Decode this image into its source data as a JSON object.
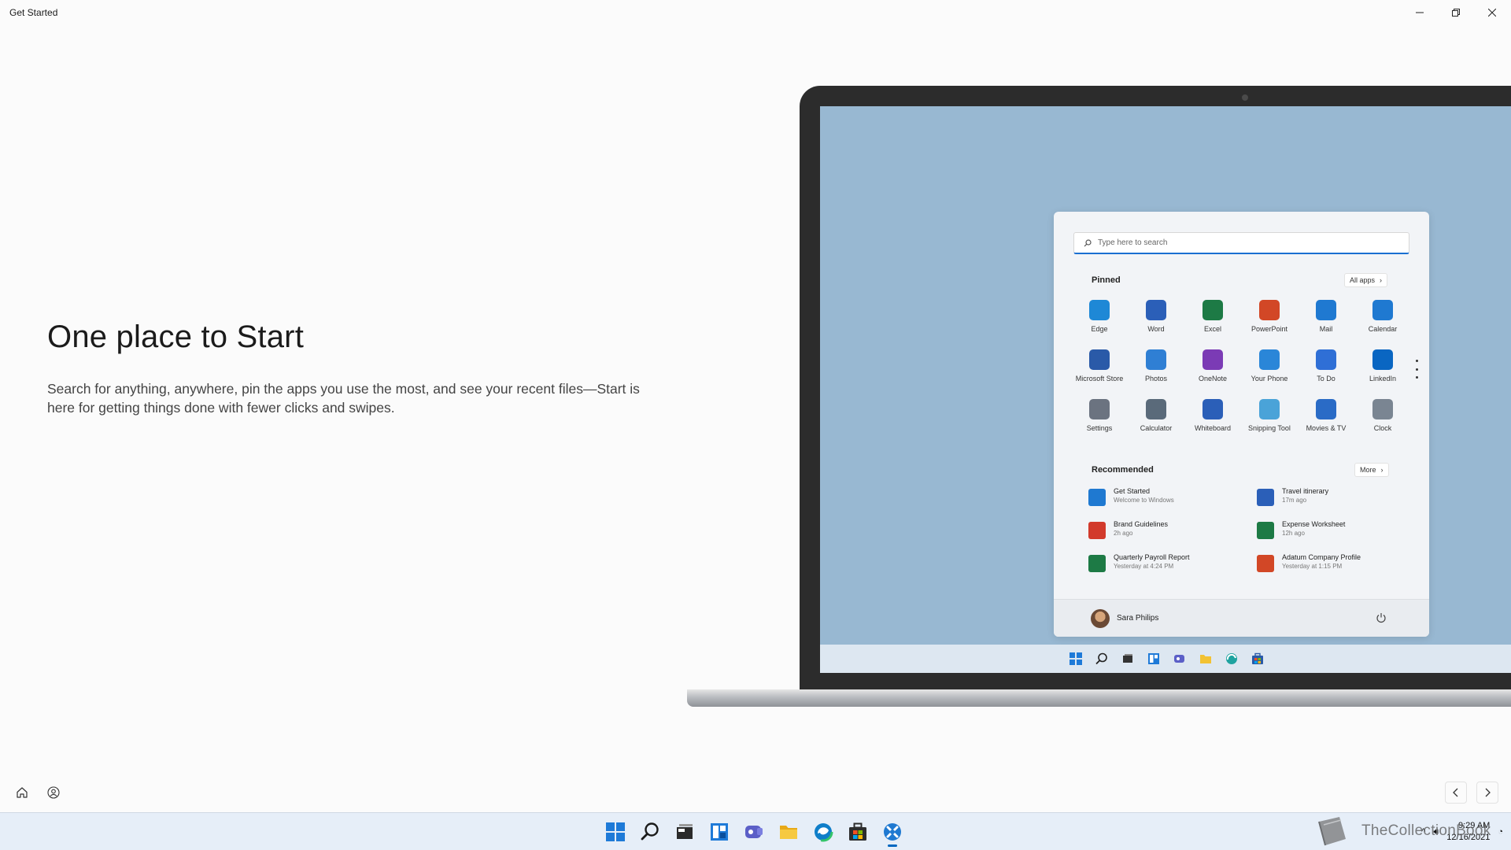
{
  "window": {
    "title": "Get Started"
  },
  "hero": {
    "headline": "One place to Start",
    "description": "Search for anything, anywhere, pin the apps you use the most, and see your recent files—Start is here for getting things done with fewer clicks and swipes."
  },
  "start_menu": {
    "search_placeholder": "Type here to search",
    "pinned_title": "Pinned",
    "all_apps_label": "All apps",
    "pinned_apps": [
      {
        "label": "Edge",
        "icon": "edge-icon",
        "color": "#1e88d6"
      },
      {
        "label": "Word",
        "icon": "word-icon",
        "color": "#2b5fb8"
      },
      {
        "label": "Excel",
        "icon": "excel-icon",
        "color": "#1d7a45"
      },
      {
        "label": "PowerPoint",
        "icon": "powerpoint-icon",
        "color": "#d24726"
      },
      {
        "label": "Mail",
        "icon": "mail-icon",
        "color": "#1f79d1"
      },
      {
        "label": "Calendar",
        "icon": "calendar-icon",
        "color": "#1f79d1"
      },
      {
        "label": "Microsoft Store",
        "icon": "store-icon",
        "color": "#2a5aa8"
      },
      {
        "label": "Photos",
        "icon": "photos-icon",
        "color": "#2f7fd4"
      },
      {
        "label": "OneNote",
        "icon": "onenote-icon",
        "color": "#7b3bb5"
      },
      {
        "label": "Your Phone",
        "icon": "phone-icon",
        "color": "#2a86d8"
      },
      {
        "label": "To Do",
        "icon": "todo-icon",
        "color": "#2f6fd6"
      },
      {
        "label": "LinkedIn",
        "icon": "linkedin-icon",
        "color": "#0a66c2"
      },
      {
        "label": "Settings",
        "icon": "settings-icon",
        "color": "#6b7380"
      },
      {
        "label": "Calculator",
        "icon": "calculator-icon",
        "color": "#5a6a7a"
      },
      {
        "label": "Whiteboard",
        "icon": "whiteboard-icon",
        "color": "#2b5fb8"
      },
      {
        "label": "Snipping Tool",
        "icon": "snipping-icon",
        "color": "#4aa3d8"
      },
      {
        "label": "Movies & TV",
        "icon": "movies-icon",
        "color": "#2a6bc6"
      },
      {
        "label": "Clock",
        "icon": "clock-icon",
        "color": "#7a8592"
      }
    ],
    "recommended_title": "Recommended",
    "more_label": "More",
    "recommended": [
      {
        "name": "Get Started",
        "sub": "Welcome to Windows",
        "icon": "get-started-icon",
        "color": "#1f79d1"
      },
      {
        "name": "Travel itinerary",
        "sub": "17m ago",
        "icon": "word-doc-icon",
        "color": "#2b5fb8"
      },
      {
        "name": "Brand Guidelines",
        "sub": "2h ago",
        "icon": "pdf-icon",
        "color": "#d23a2c"
      },
      {
        "name": "Expense Worksheet",
        "sub": "12h ago",
        "icon": "excel-doc-icon",
        "color": "#1d7a45"
      },
      {
        "name": "Quarterly Payroll Report",
        "sub": "Yesterday at 4:24 PM",
        "icon": "excel-doc-icon",
        "color": "#1d7a45"
      },
      {
        "name": "Adatum Company Profile",
        "sub": "Yesterday at 1:15 PM",
        "icon": "powerpoint-doc-icon",
        "color": "#d24726"
      }
    ],
    "user_name": "Sara Philips"
  },
  "taskbar": {
    "time": "9:29 AM",
    "date": "12/16/2021",
    "apps": [
      "start-icon",
      "search-icon",
      "task-view-icon",
      "widgets-icon",
      "chat-icon",
      "file-explorer-icon",
      "edge-icon",
      "store-icon",
      "get-started-icon"
    ]
  },
  "watermark": {
    "text": "TheCollectionBook"
  }
}
